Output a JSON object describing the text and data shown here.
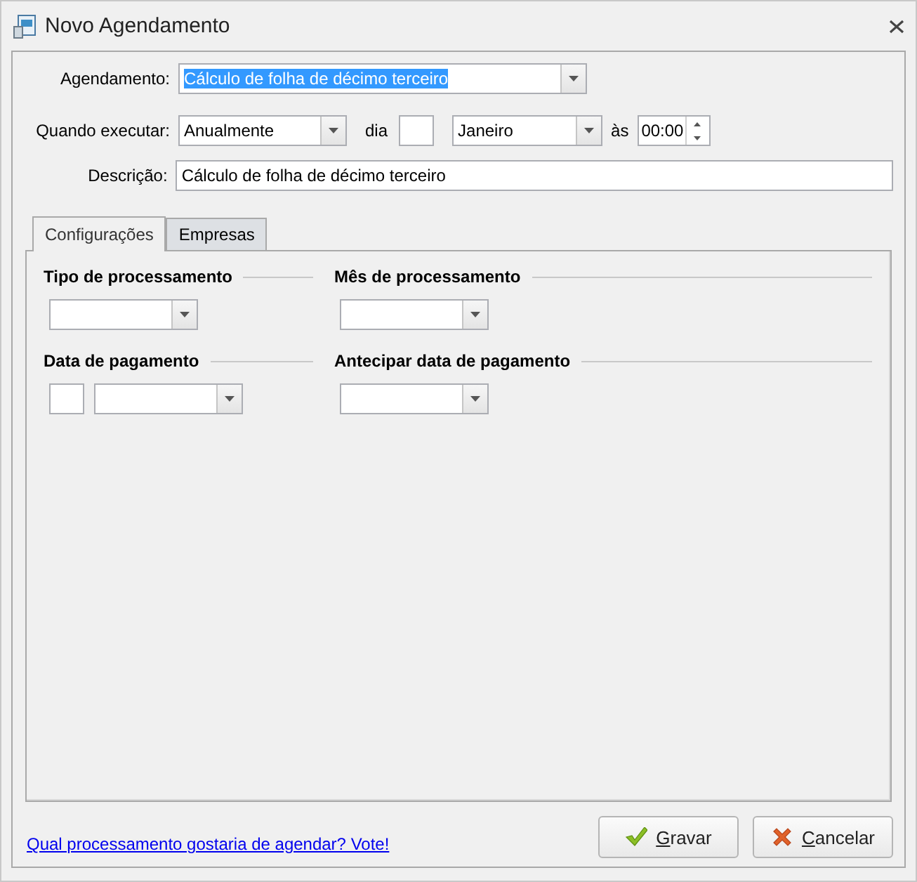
{
  "window": {
    "title": "Novo Agendamento"
  },
  "schedule": {
    "label": "Agendamento:",
    "value": "Cálculo de folha de décimo terceiro",
    "text_selected": true
  },
  "when": {
    "label": "Quando executar:",
    "frequency": "Anualmente",
    "day_label": "dia",
    "month": "Janeiro",
    "time_label": "às",
    "time": "00:00"
  },
  "description": {
    "label": "Descrição:",
    "value": "Cálculo de folha de décimo terceiro"
  },
  "tabs": [
    {
      "label": "Configurações",
      "selected": true
    },
    {
      "label": "Empresas",
      "selected": false
    }
  ],
  "sections": [
    {
      "title": "Tipo de processamento",
      "controls": [
        {
          "kind": "combo"
        }
      ]
    },
    {
      "title": "Mês de processamento",
      "controls": [
        {
          "kind": "combo"
        }
      ]
    },
    {
      "title": "Data de pagamento",
      "controls": [
        {
          "kind": "field"
        },
        {
          "kind": "combo"
        }
      ]
    },
    {
      "title": "Antecipar data de pagamento",
      "controls": [
        {
          "kind": "combo"
        }
      ]
    }
  ],
  "footer": {
    "link": "Qual processamento gostaria de agendar? Vote!",
    "buttons": [
      {
        "label": "Gravar",
        "kind": "confirm"
      },
      {
        "label": "Cancelar",
        "kind": "cancel"
      }
    ]
  }
}
